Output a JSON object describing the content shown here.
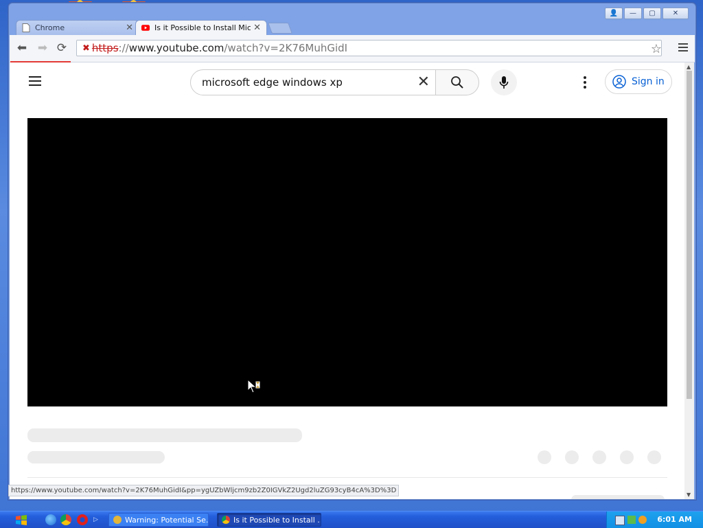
{
  "window": {
    "controls": {
      "user": "👤",
      "minimize": "—",
      "maximize": "▢",
      "close": "✕"
    }
  },
  "tabs": [
    {
      "label": "Chrome",
      "icon": "page-icon",
      "active": false
    },
    {
      "label": "Is it Possible to Install Micros",
      "icon": "youtube-icon",
      "active": true
    }
  ],
  "toolbar": {
    "url_scheme": "https",
    "url_sep": "://",
    "url_host": "www.youtube.com",
    "url_path": "/watch?v=2K76MuhGidI"
  },
  "youtube": {
    "search_value": "microsoft edge windows xp",
    "sign_in": "Sign in"
  },
  "status_bar": {
    "url": "https://www.youtube.com/watch?v=2K76MuhGidI&pp=ygUZbWljcm9zb2Z0IGVkZ2Ugd2luZG93cyB4cA%3D%3D"
  },
  "taskbar": {
    "tasks": [
      {
        "label": "Warning: Potential Se...",
        "icon": "warning-app-icon"
      },
      {
        "label": "Is it Possible to Install ...",
        "icon": "chrome-icon",
        "active": true
      }
    ],
    "clock": "6:01 AM"
  },
  "colors": {
    "youtube_red": "#ff0000",
    "link_blue": "#065fd4",
    "xp_blue": "#245edb",
    "loading_red": "#e53935"
  }
}
